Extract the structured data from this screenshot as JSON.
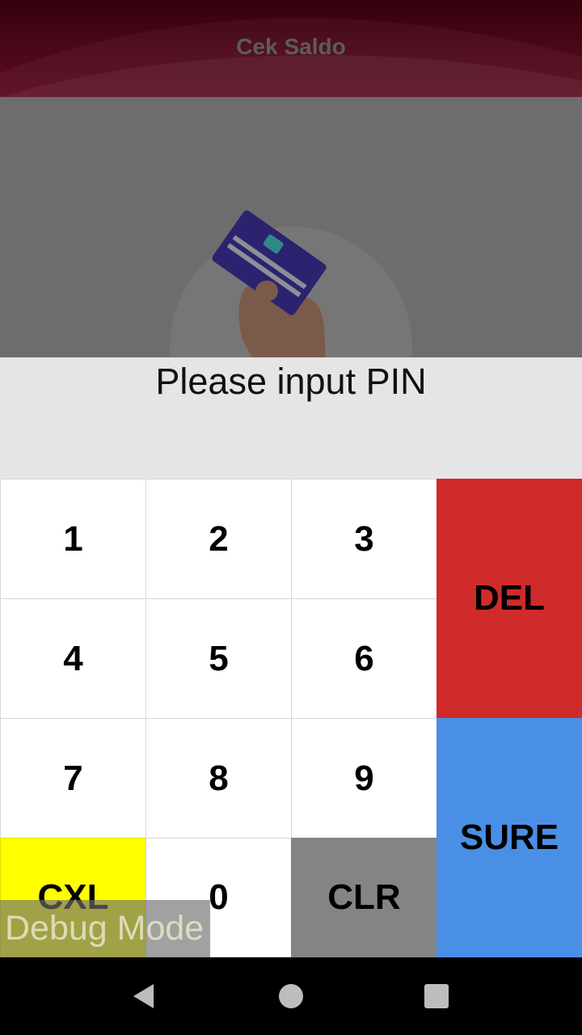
{
  "app_bar": {
    "title": "Cek Saldo"
  },
  "illustration": {
    "icon": "card-in-hand-icon"
  },
  "prompt": {
    "text": "Please input PIN"
  },
  "keypad": {
    "keys": {
      "k1": "1",
      "k2": "2",
      "k3": "3",
      "k4": "4",
      "k5": "5",
      "k6": "6",
      "k7": "7",
      "k8": "8",
      "k9": "9",
      "k0": "0",
      "del": "DEL",
      "sure": "SURE",
      "cxl": "CXL",
      "clr": "CLR"
    },
    "colors": {
      "del": "#cf2b2a",
      "sure": "#4a8fe6",
      "cxl": "#ffff00",
      "clr": "#848484"
    }
  },
  "debug": {
    "label": "Debug Mode"
  },
  "nav_bar": {
    "back_icon": "triangle-back-icon",
    "home_icon": "circle-home-icon",
    "recents_icon": "square-recents-icon"
  }
}
